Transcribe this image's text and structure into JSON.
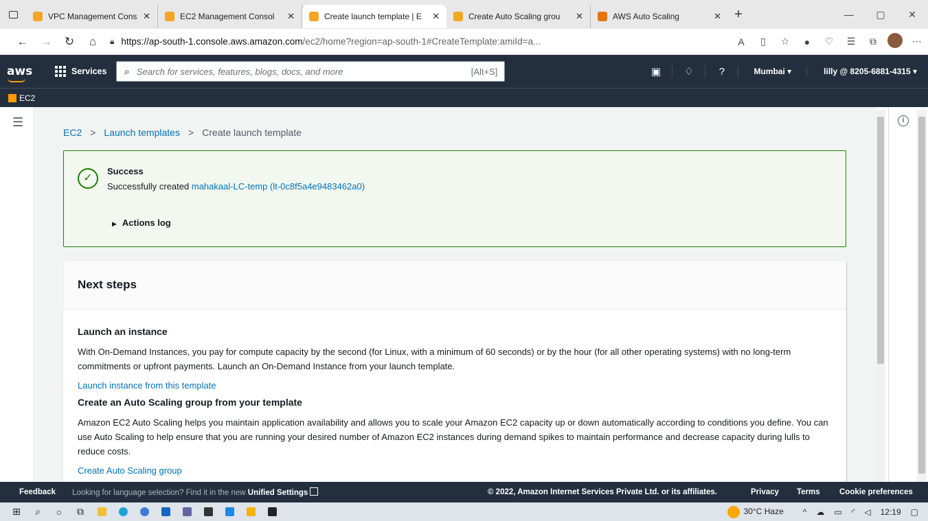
{
  "browser": {
    "tabs": [
      {
        "label": "VPC Management Consol",
        "active": false,
        "favicon": "aws-orange"
      },
      {
        "label": "EC2 Management Consol",
        "active": false,
        "favicon": "aws-orange"
      },
      {
        "label": "Create launch template | E",
        "active": true,
        "favicon": "aws-orange"
      },
      {
        "label": "Create Auto Scaling grou",
        "active": false,
        "favicon": "aws-orange"
      },
      {
        "label": "AWS Auto Scaling",
        "active": false,
        "favicon": "aws-cube"
      }
    ],
    "url_host": "https://ap-south-1.console.aws.amazon.com",
    "url_rest": "/ec2/home?region=ap-south-1#CreateTemplate:amiId=a..."
  },
  "aws_header": {
    "logo": "aws",
    "services_label": "Services",
    "search_placeholder": "Search for services, features, blogs, docs, and more",
    "search_shortcut": "[Alt+S]",
    "region": "Mumbai ▾",
    "account": "lilly @ 8205-6881-4315 ▾",
    "service_name": "EC2"
  },
  "breadcrumb": {
    "items": [
      "EC2",
      "Launch templates"
    ],
    "current": "Create launch template"
  },
  "flash": {
    "title": "Success",
    "message_prefix": "Successfully created",
    "resource_link": "mahakaal-LC-temp (lt-0c8f5a4e9483462a0)",
    "actions_log": "Actions log",
    "color": "#1d8102"
  },
  "next_steps": {
    "heading": "Next steps",
    "launch": {
      "title": "Launch an instance",
      "body": "With On-Demand Instances, you pay for compute capacity by the second (for Linux, with a minimum of 60 seconds) or by the hour (for all other operating systems) with no long-term commitments or upfront payments. Launch an On-Demand Instance from your launch template.",
      "link": "Launch instance from this template"
    },
    "asg": {
      "title": "Create an Auto Scaling group from your template",
      "body": "Amazon EC2 Auto Scaling helps you maintain application availability and allows you to scale your Amazon EC2 capacity up or down automatically according to conditions you define. You can use Auto Scaling to help ensure that you are running your desired number of Amazon EC2 instances during demand spikes to maintain performance and decrease capacity during lulls to reduce costs.",
      "link": "Create Auto Scaling group"
    }
  },
  "footer": {
    "feedback": "Feedback",
    "lang_text": "Looking for language selection? Find it in the new",
    "lang_link": "Unified Settings",
    "copyright": "© 2022, Amazon Internet Services Private Ltd. or its affiliates.",
    "privacy": "Privacy",
    "terms": "Terms",
    "cookies": "Cookie preferences"
  },
  "taskbar": {
    "weather": "30°C  Haze",
    "time": "12:19"
  },
  "colors": {
    "aws_nav": "#232f3e",
    "aws_orange": "#ff9900",
    "link_blue": "#0073bb"
  }
}
